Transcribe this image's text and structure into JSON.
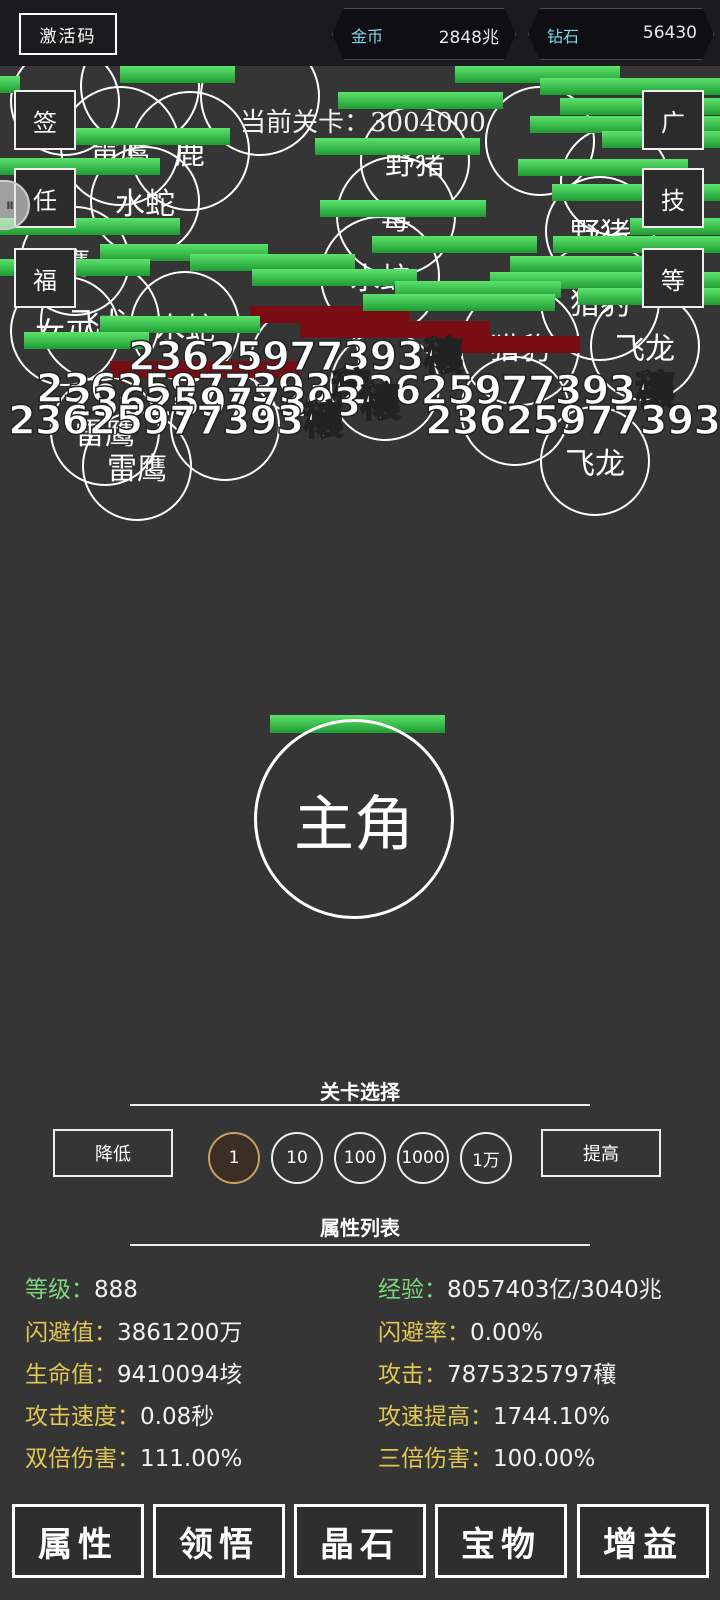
{
  "topbar": {
    "activate_label": "激活码",
    "gold": {
      "label": "金币",
      "value": "2848兆"
    },
    "diamond": {
      "label": "钻石",
      "value": "56430"
    }
  },
  "battle": {
    "stage_text": "当前关卡：3004000",
    "hero_label": "主角",
    "left_buttons": [
      "签",
      "任",
      "福"
    ],
    "right_buttons": [
      "广",
      "技",
      "等"
    ],
    "enemies": [
      "雷鹰",
      "雷鹰",
      "巫",
      "水蛇",
      "鹰",
      "野猪",
      "水蛇",
      "飞龙",
      "女巫",
      "女巫",
      "飞龙",
      "野猪",
      "猎豹",
      "飞龙",
      "雷鹰",
      "雷鹰",
      "鹿",
      "毒",
      "猎豹",
      "野猪",
      "雷鹰"
    ],
    "damage_text": "2362597739​3穰"
  },
  "stage_select": {
    "title": "关卡选择",
    "lower_label": "降低",
    "raise_label": "提高",
    "steps": [
      "1",
      "10",
      "100",
      "1000",
      "1万"
    ],
    "selected": "1"
  },
  "attributes": {
    "title": "属性列表",
    "items": [
      {
        "key": "等级：",
        "value": "888"
      },
      {
        "key": "经验：",
        "value": "8057403亿/3040兆"
      },
      {
        "key": "闪避值：",
        "value": "3861200万"
      },
      {
        "key": "闪避率：",
        "value": "0.00%"
      },
      {
        "key": "生命值：",
        "value": "9410094垓"
      },
      {
        "key": "攻击：",
        "value": "7875325797穰"
      },
      {
        "key": "攻击速度：",
        "value": "0.08秒"
      },
      {
        "key": "攻速提高：",
        "value": "1744.10%"
      },
      {
        "key": "双倍伤害：",
        "value": "111.00%"
      },
      {
        "key": "三倍伤害：",
        "value": "100.00%"
      }
    ]
  },
  "nav": [
    "属性",
    "领悟",
    "晶石",
    "宝物",
    "增益"
  ],
  "colors": {
    "hp_green": "#2fbf45",
    "hp_red": "#7a0d14",
    "attr_key": "#e0c653",
    "attr_key_green": "#7cd67e",
    "currency_label": "#7fd6e8"
  }
}
